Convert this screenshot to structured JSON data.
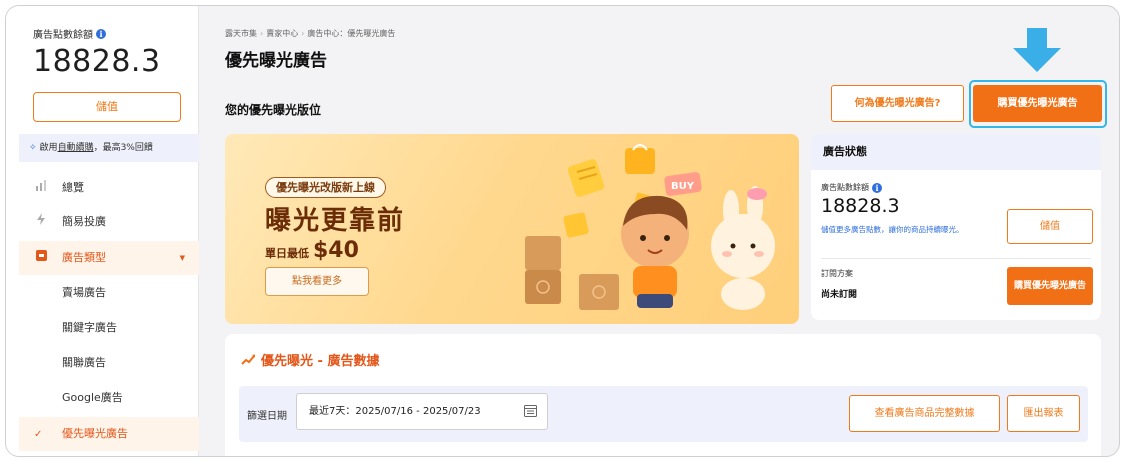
{
  "sidebar": {
    "balance_label": "廣告點數餘額",
    "balance_value": "18828.3",
    "topup_label": "儲值",
    "auto_renew": {
      "prefix": "啟用",
      "link": "自動續購",
      "suffix": "，最高3%回饋"
    },
    "nav": [
      {
        "label": "總覽",
        "icon": "chart-bars-icon"
      },
      {
        "label": "簡易投廣",
        "icon": "lightning-icon"
      },
      {
        "label": "廣告類型",
        "icon": "ad-square-icon",
        "expanded": true
      }
    ],
    "sub_items": [
      {
        "label": "賣場廣告"
      },
      {
        "label": "關鍵字廣告"
      },
      {
        "label": "關聯廣告"
      },
      {
        "label": "Google廣告"
      },
      {
        "label": "優先曝光廣告",
        "current": true
      }
    ]
  },
  "header": {
    "breadcrumb": [
      "露天市集",
      "賣家中心",
      "廣告中心：優先曝光廣告"
    ],
    "title": "優先曝光廣告",
    "section_title": "您的優先曝光版位",
    "what_is_label": "何為優先曝光廣告?",
    "buy_label": "購買優先曝光廣告"
  },
  "banner": {
    "tag": "優先曝光改版新上線",
    "headline": "曝光更靠前",
    "sub_prefix": "單日最低",
    "price": "$40",
    "cta": "點我看更多",
    "sticker_text": "BUY"
  },
  "status": {
    "title": "廣告狀態",
    "balance_label": "廣告點數餘額",
    "balance_value": "18828.3",
    "note": "儲值更多廣告點數，讓你的商品持續曝光。",
    "topup_label": "儲值",
    "plan_label": "訂閱方案",
    "plan_value": "尚未訂閱",
    "buy_label": "購買優先曝光廣告"
  },
  "data_section": {
    "title": "優先曝光 - 廣告數據",
    "filter_label": "篩選日期",
    "date_range": "最近7天：2025/07/16 - 2025/07/23",
    "view_full_label": "查看廣告商品完整數據",
    "export_label": "匯出報表"
  },
  "colors": {
    "accent": "#f27015",
    "accent_text": "#e4571a",
    "highlight_border": "#33b6e8",
    "info_blue": "#2f6fdc",
    "panel_bg": "#eef1fb"
  }
}
